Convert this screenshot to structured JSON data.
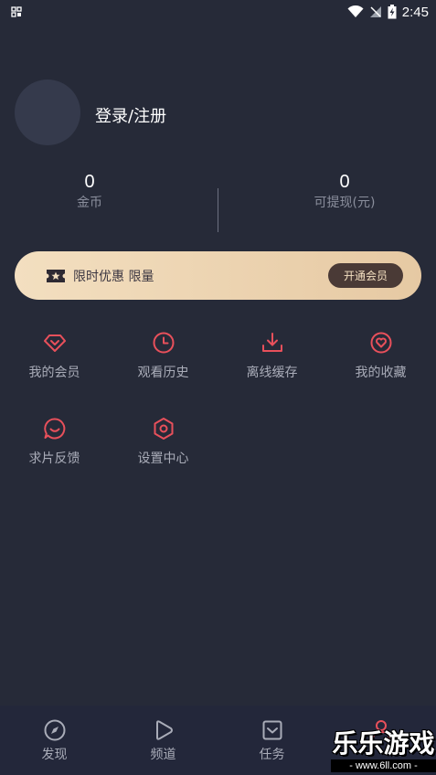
{
  "status_bar": {
    "time": "2:45"
  },
  "profile": {
    "login_label": "登录/注册"
  },
  "stats": {
    "coins_value": "0",
    "coins_label": "金币",
    "cash_value": "0",
    "cash_label": "可提现(元)"
  },
  "vip_banner": {
    "text": "限时优惠 限量",
    "button_label": "开通会员"
  },
  "menu": {
    "items": [
      {
        "label": "我的会员",
        "icon": "diamond-icon"
      },
      {
        "label": "观看历史",
        "icon": "clock-icon"
      },
      {
        "label": "离线缓存",
        "icon": "download-icon"
      },
      {
        "label": "我的收藏",
        "icon": "heart-icon"
      },
      {
        "label": "求片反馈",
        "icon": "chat-icon"
      },
      {
        "label": "设置中心",
        "icon": "gear-icon"
      }
    ]
  },
  "bottom_nav": {
    "items": [
      {
        "label": "发现",
        "icon": "compass-icon"
      },
      {
        "label": "频道",
        "icon": "play-icon"
      },
      {
        "label": "任务",
        "icon": "task-icon"
      },
      {
        "label": "",
        "icon": "user-icon",
        "active": true
      }
    ]
  },
  "watermark": {
    "title": "乐乐游戏",
    "url": "- www.6ll.com -"
  },
  "colors": {
    "background": "#262a38",
    "accent": "#e8505b",
    "banner_gold": "#f3dfc0"
  }
}
